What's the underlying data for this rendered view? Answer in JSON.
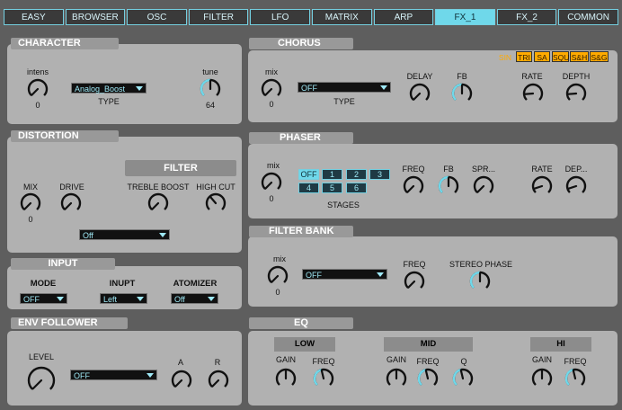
{
  "tabs": [
    "EASY",
    "BROWSER",
    "OSC",
    "FILTER",
    "LFO",
    "MATRIX",
    "ARP",
    "FX_1",
    "FX_2",
    "COMMON"
  ],
  "active_tab": "FX_1",
  "accent_color": "#6fd8ea",
  "wave_color": "#ffaa00",
  "character": {
    "title": "CHARACTER",
    "intens_label": "intens",
    "intens_value": "0",
    "type_value": "Analog_Boost",
    "type_label": "TYPE",
    "tune_label": "tune",
    "tune_value": "64"
  },
  "distortion": {
    "title": "DISTORTION",
    "mix_label": "MIX",
    "mix_value": "0",
    "drive_label": "DRIVE",
    "filter_header": "FILTER",
    "treble_label": "TREBLE BOOST",
    "highcut_label": "HIGH CUT",
    "select_value": "Off"
  },
  "input": {
    "title": "INPUT",
    "mode_label": "MODE",
    "mode_value": "OFF",
    "inupt_label": "INUPT",
    "inupt_value": "Left",
    "atomizer_label": "ATOMIZER",
    "atomizer_value": "Off"
  },
  "env": {
    "title": "ENV FOLLOWER",
    "level_label": "LEVEL",
    "select_value": "OFF",
    "a_label": "A",
    "r_label": "R"
  },
  "chorus": {
    "title": "CHORUS",
    "mix_label": "mix",
    "mix_value": "0",
    "type_value": "OFF",
    "type_label": "TYPE",
    "delay_label": "DELAY",
    "fb_label": "FB",
    "rate_label": "RATE",
    "depth_label": "DEPTH",
    "waves": [
      "SIN",
      "TRI",
      "SA",
      "SQU",
      "S&H",
      "S&G"
    ]
  },
  "phaser": {
    "title": "PHASER",
    "mix_label": "mix",
    "mix_value": "0",
    "stages": [
      "OFF",
      "1",
      "2",
      "3",
      "4",
      "5",
      "6"
    ],
    "stages_label": "STAGES",
    "freq_label": "FREQ",
    "fb_label": "FB",
    "spr_label": "SPR...",
    "rate_label": "RATE",
    "dep_label": "DEP..."
  },
  "filterbank": {
    "title": "FILTER BANK",
    "mix_label": "mix",
    "mix_value": "0",
    "select_value": "OFF",
    "freq_label": "FREQ",
    "stereo_label": "STEREO PHASE"
  },
  "eq": {
    "title": "EQ",
    "low_header": "LOW",
    "mid_header": "MID",
    "hi_header": "HI",
    "gain_label": "GAIN",
    "freq_label": "FREQ",
    "q_label": "Q"
  }
}
